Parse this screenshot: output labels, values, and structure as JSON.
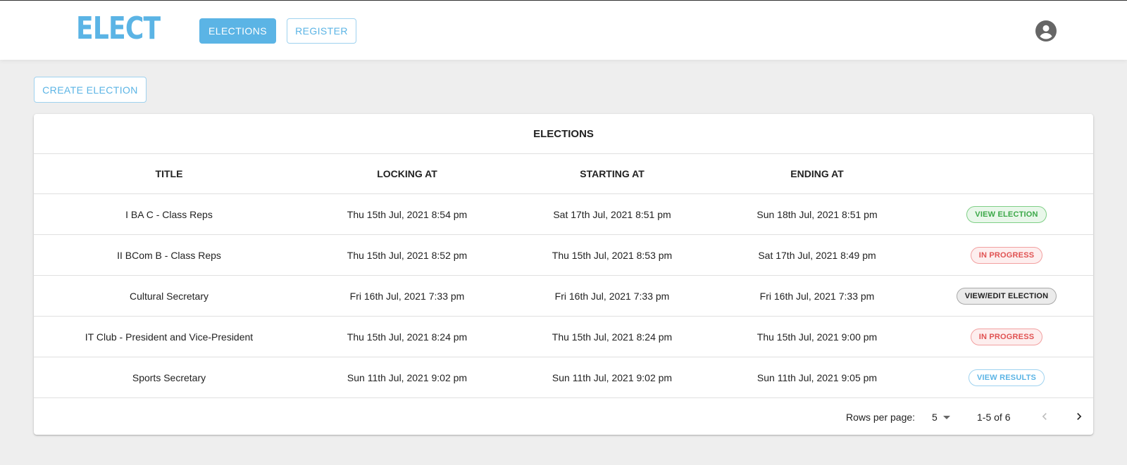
{
  "header": {
    "logo": "ELECT",
    "nav": [
      {
        "label": "ELECTIONS",
        "active": true
      },
      {
        "label": "REGISTER",
        "active": false
      }
    ],
    "account_icon": "account-circle-icon"
  },
  "toolbar": {
    "create_label": "CREATE ELECTION"
  },
  "table": {
    "title": "ELECTIONS",
    "columns": [
      "TITLE",
      "LOCKING AT",
      "STARTING AT",
      "ENDING AT",
      ""
    ],
    "rows": [
      {
        "title": "I BA C - Class Reps",
        "locking": "Thu 15th Jul, 2021 8:54 pm",
        "starting": "Sat 17th Jul, 2021 8:51 pm",
        "ending": "Sun 18th Jul, 2021 8:51 pm",
        "action": "VIEW ELECTION",
        "action_style": "green"
      },
      {
        "title": "II BCom B - Class Reps",
        "locking": "Thu 15th Jul, 2021 8:52 pm",
        "starting": "Thu 15th Jul, 2021 8:53 pm",
        "ending": "Sat 17th Jul, 2021 8:49 pm",
        "action": "IN PROGRESS",
        "action_style": "red"
      },
      {
        "title": "Cultural Secretary",
        "locking": "Fri 16th Jul, 2021 7:33 pm",
        "starting": "Fri 16th Jul, 2021 7:33 pm",
        "ending": "Fri 16th Jul, 2021 7:33 pm",
        "action": "VIEW/EDIT ELECTION",
        "action_style": "grey"
      },
      {
        "title": "IT Club - President and Vice-President",
        "locking": "Thu 15th Jul, 2021 8:24 pm",
        "starting": "Thu 15th Jul, 2021 8:24 pm",
        "ending": "Thu 15th Jul, 2021 9:00 pm",
        "action": "IN PROGRESS",
        "action_style": "red"
      },
      {
        "title": "Sports Secretary",
        "locking": "Sun 11th Jul, 2021 9:02 pm",
        "starting": "Sun 11th Jul, 2021 9:02 pm",
        "ending": "Sun 11th Jul, 2021 9:05 pm",
        "action": "VIEW RESULTS",
        "action_style": "blue"
      }
    ]
  },
  "pagination": {
    "rows_per_page_label": "Rows per page:",
    "rows_per_page": "5",
    "range": "1-5 of 6",
    "prev_icon": "chevron-left-icon",
    "next_icon": "chevron-right-icon"
  },
  "colors": {
    "accent": "#5bb4e5",
    "background": "#eeeeee",
    "chip_green": "#3ba848",
    "chip_red": "#e05252"
  }
}
